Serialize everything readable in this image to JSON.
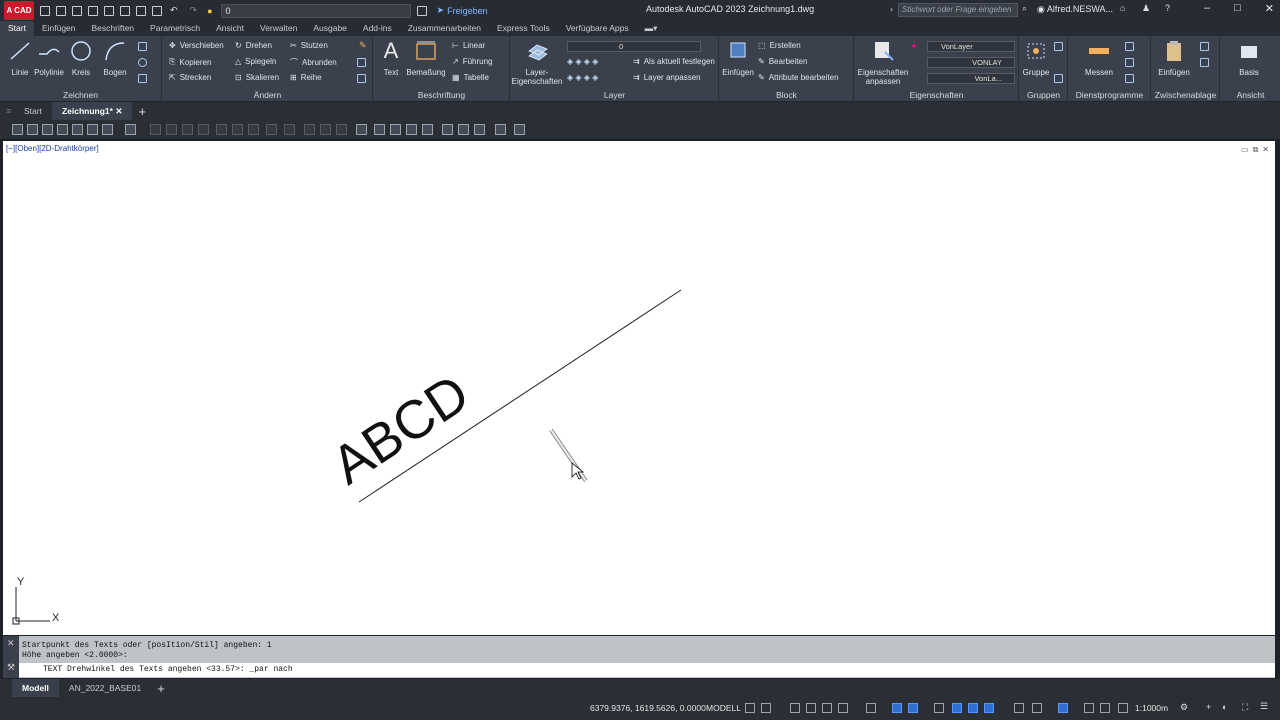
{
  "app": {
    "badge": "A CAD",
    "title": "Autodesk AutoCAD 2023   Zeichnung1.dwg",
    "share_label": "Freigeben",
    "search_placeholder": "Stichwort oder Frage eingeben",
    "user": "Alfred.NESWA...",
    "quick_layer": "0"
  },
  "ribbon_tabs": [
    "Start",
    "Einfügen",
    "Beschriften",
    "Parametrisch",
    "Ansicht",
    "Verwalten",
    "Ausgabe",
    "Add-ins",
    "Zusammenarbeiten",
    "Express Tools",
    "Verfügbare Apps"
  ],
  "panels": {
    "zeichnen": {
      "title": "Zeichnen",
      "linie": "Linie",
      "polylinie": "Polylinie",
      "kreis": "Kreis",
      "bogen": "Bogen"
    },
    "aendern": {
      "title": "Ändern",
      "verschieben": "Verschieben",
      "drehen": "Drehen",
      "stutzen": "Stutzen",
      "kopieren": "Kopieren",
      "spiegeln": "Spiegeln",
      "abrunden": "Abrunden",
      "strecken": "Strecken",
      "skalieren": "Skalieren",
      "reihe": "Reihe"
    },
    "beschriftung": {
      "title": "Beschriftung",
      "text": "Text",
      "bemassung": "Bemaßung",
      "linear": "Linear",
      "fuehrung": "Führung",
      "tabelle": "Tabelle"
    },
    "layer": {
      "title": "Layer",
      "layer_eig": "Layer-Eigenschaften",
      "current": "0",
      "aktuell": "Als aktuell festlegen",
      "anpassen": "Layer anpassen"
    },
    "block": {
      "title": "Block",
      "einfuegen": "Einfügen",
      "erstellen": "Erstellen",
      "bearbeiten": "Bearbeiten",
      "attribute": "Attribute bearbeiten"
    },
    "eigenschaften": {
      "title": "Eigenschaften",
      "anpassen": "Eigenschaften anpassen",
      "color": "VonLayer",
      "linetype": "VONLAY",
      "lineweight": "VonLa..."
    },
    "gruppen": {
      "title": "Gruppen",
      "gruppe": "Gruppe"
    },
    "dienst": {
      "title": "Dienstprogramme",
      "messen": "Messen"
    },
    "zwischen": {
      "title": "Zwischenablage",
      "einfuegen": "Einfügen"
    },
    "ansicht": {
      "title": "Ansicht",
      "basis": "Basis"
    }
  },
  "doc_tabs": [
    "Start",
    "Zeichnung1*"
  ],
  "viewport": {
    "label": "[−][Oben][2D-Drahtkörper]",
    "drawing_text": "ABCD",
    "ucs_x": "X",
    "ucs_y": "Y"
  },
  "command": {
    "history1": "Startpunkt des Texts  oder [posItion/Stil] angeben: 1",
    "history2": "Höhe angeben <2.0000>:",
    "prompt": "TEXT Drehwinkel des Texts angeben <33.57>: _par nach"
  },
  "layout_tabs": [
    "Modell",
    "AN_2022_BASE01"
  ],
  "status": {
    "coords": "6379.9376, 1619.5626, 0.0000",
    "modell": "MODELL",
    "scale": "1:1000m"
  }
}
